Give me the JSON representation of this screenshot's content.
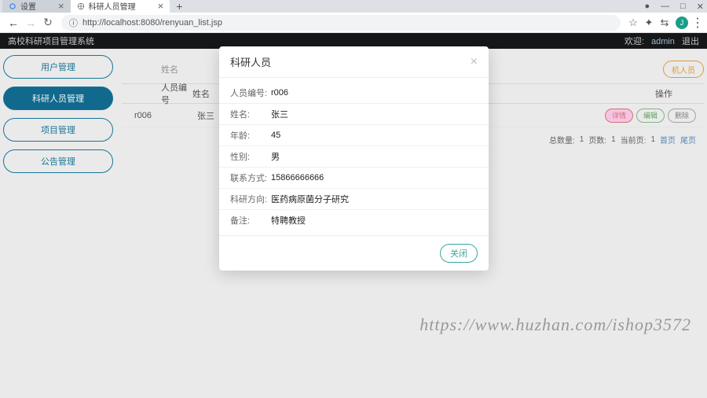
{
  "browser": {
    "tabs": [
      {
        "title": "设置"
      },
      {
        "title": "科研人员管理"
      }
    ],
    "url": "http://localhost:8080/renyuan_list.jsp",
    "avatar_letter": "J"
  },
  "header": {
    "app_title": "高校科研项目管理系统",
    "welcome": "欢迎:",
    "user": "admin",
    "logout": "退出"
  },
  "sidebar": {
    "items": [
      {
        "label": "用户管理"
      },
      {
        "label": "科研人员管理"
      },
      {
        "label": "项目管理"
      },
      {
        "label": "公告管理"
      }
    ]
  },
  "search": {
    "label": "姓名",
    "add_button": "机人员"
  },
  "table": {
    "headers": {
      "id": "人员编号",
      "name": "姓名",
      "ops": "操作"
    },
    "rows": [
      {
        "id": "r006",
        "name": "张三"
      }
    ],
    "ops": {
      "view": "详情",
      "edit": "编辑",
      "del": "删除"
    }
  },
  "pager": {
    "total_label": "总数量:",
    "total_val": "1",
    "pages_label": "页数:",
    "pages_val": "1",
    "current_label": "当前页:",
    "current_val": "1",
    "first": "首页",
    "last": "尾页"
  },
  "modal": {
    "title": "科研人员",
    "fields": [
      {
        "label": "人员编号:",
        "value": "r006"
      },
      {
        "label": "姓名:",
        "value": "张三"
      },
      {
        "label": "年龄:",
        "value": "45"
      },
      {
        "label": "性别:",
        "value": "男"
      },
      {
        "label": "联系方式:",
        "value": "15866666666"
      },
      {
        "label": "科研方向:",
        "value": "医药病原菌分子研究"
      },
      {
        "label": "备注:",
        "value": "特聘教授"
      }
    ],
    "close_button": "关闭"
  },
  "watermark": "https://www.huzhan.com/ishop3572"
}
